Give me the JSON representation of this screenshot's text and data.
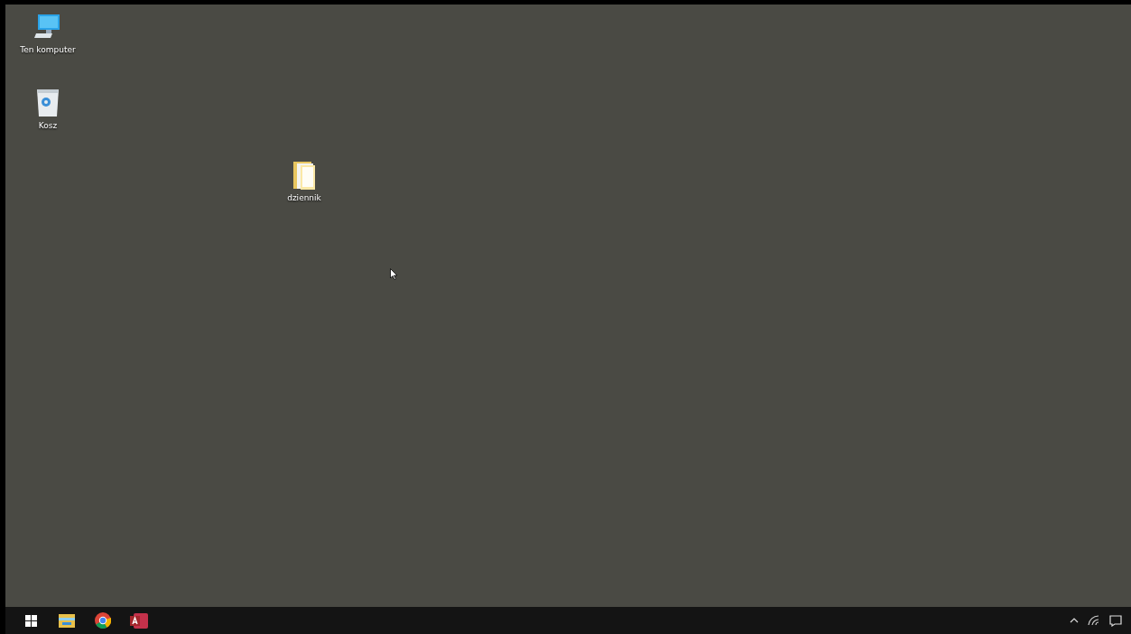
{
  "desktop_icons": [
    {
      "label": "Ten komputer",
      "kind": "computer"
    },
    {
      "label": "Kosz",
      "kind": "recycle-bin"
    },
    {
      "label": "dziennik",
      "kind": "folder"
    }
  ]
}
